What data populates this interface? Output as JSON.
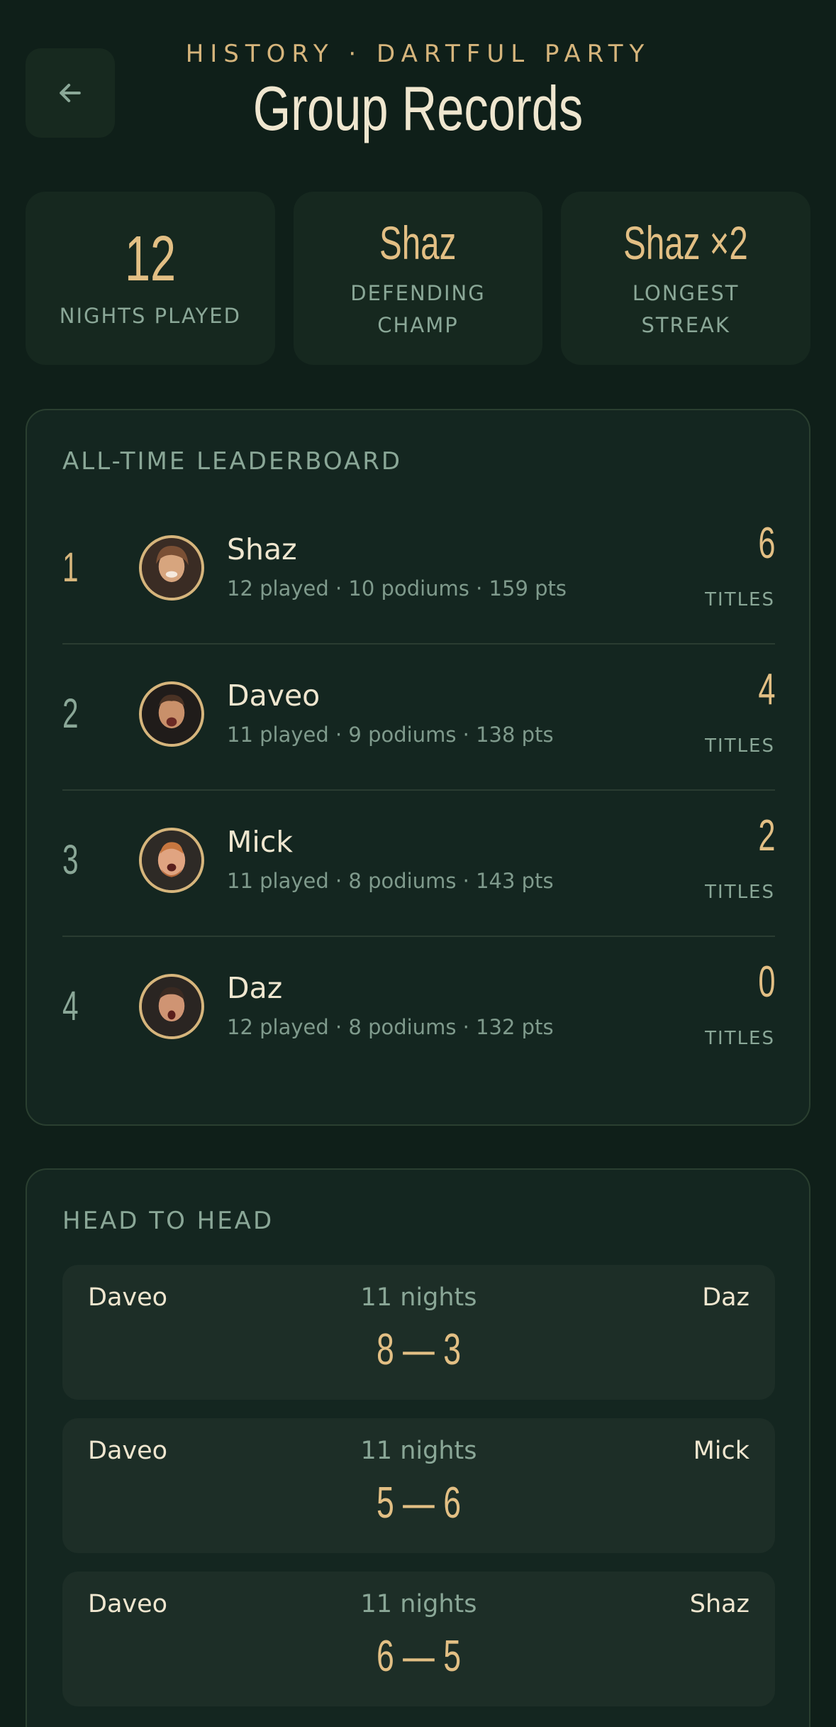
{
  "header": {
    "eyebrow": "HISTORY · DARTFUL PARTY",
    "title": "Group Records",
    "back_icon": "arrow-left-icon"
  },
  "stats": [
    {
      "value": "12",
      "label": "NIGHTS PLAYED"
    },
    {
      "value": "Shaz",
      "label": "DEFENDING CHAMP"
    },
    {
      "value": "Shaz ×2",
      "label": "LONGEST STREAK"
    }
  ],
  "leaderboard": {
    "title": "ALL-TIME LEADERBOARD",
    "titles_label": "TITLES",
    "rows": [
      {
        "rank": "1",
        "name": "Shaz",
        "meta": "12 played · 10 podiums · 159 pts",
        "titles": "6"
      },
      {
        "rank": "2",
        "name": "Daveo",
        "meta": "11 played · 9 podiums · 138 pts",
        "titles": "4"
      },
      {
        "rank": "3",
        "name": "Mick",
        "meta": "11 played · 8 podiums · 143 pts",
        "titles": "2"
      },
      {
        "rank": "4",
        "name": "Daz",
        "meta": "12 played · 8 podiums · 132 pts",
        "titles": "0"
      }
    ]
  },
  "head_to_head": {
    "title": "HEAD TO HEAD",
    "rows": [
      {
        "left": "Daveo",
        "nights": "11 nights",
        "right": "Daz",
        "score": "8 — 3"
      },
      {
        "left": "Daveo",
        "nights": "11 nights",
        "right": "Mick",
        "score": "5 — 6"
      },
      {
        "left": "Daveo",
        "nights": "11 nights",
        "right": "Shaz",
        "score": "6 — 5"
      }
    ]
  },
  "colors": {
    "background": "#0f1f19",
    "accent": "#e2bf84",
    "muted": "#8aa797",
    "text": "#efe6cf"
  }
}
